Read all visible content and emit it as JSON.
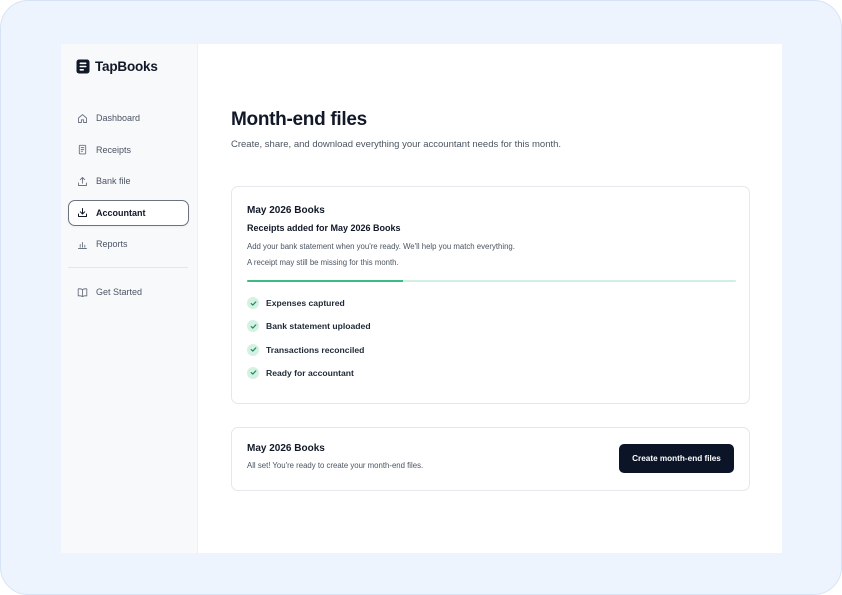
{
  "app": {
    "name": "TapBooks",
    "logo_icon": "book-icon"
  },
  "sidebar": {
    "items": [
      {
        "label": "Dashboard",
        "icon": "home-icon"
      },
      {
        "label": "Receipts",
        "icon": "receipt-icon"
      },
      {
        "label": "Bank file",
        "icon": "upload-icon"
      },
      {
        "label": "Accountant",
        "icon": "download-icon",
        "active": true
      },
      {
        "label": "Reports",
        "icon": "bar-chart-icon"
      }
    ],
    "footer_items": [
      {
        "label": "Get Started",
        "icon": "book-open-icon"
      }
    ]
  },
  "main": {
    "title": "Month-end files",
    "subtitle": "Create, share, and download everything your accountant needs for this month.",
    "status_card": {
      "title": "May 2026 Books",
      "headline": "Receipts added for May 2026 Books",
      "note1": "Add your bank statement when you're ready. We'll help you match everything.",
      "note2": "A receipt may still be missing for this month.",
      "progress_fraction": 0.32,
      "checklist": [
        {
          "label": "Expenses captured",
          "done": true
        },
        {
          "label": "Bank statement uploaded",
          "done": true
        },
        {
          "label": "Transactions reconciled",
          "done": true
        },
        {
          "label": "Ready for accountant",
          "done": true
        }
      ]
    },
    "action_card": {
      "title": "May 2026 Books",
      "note": "All set! You're ready to create your month-end files.",
      "button_label": "Create month-end files"
    }
  },
  "colors": {
    "accent_green": "#3dbb84",
    "check_bg": "#d4f1e3",
    "primary_button": "#0c1527",
    "frame_bg": "#eef4fd"
  }
}
